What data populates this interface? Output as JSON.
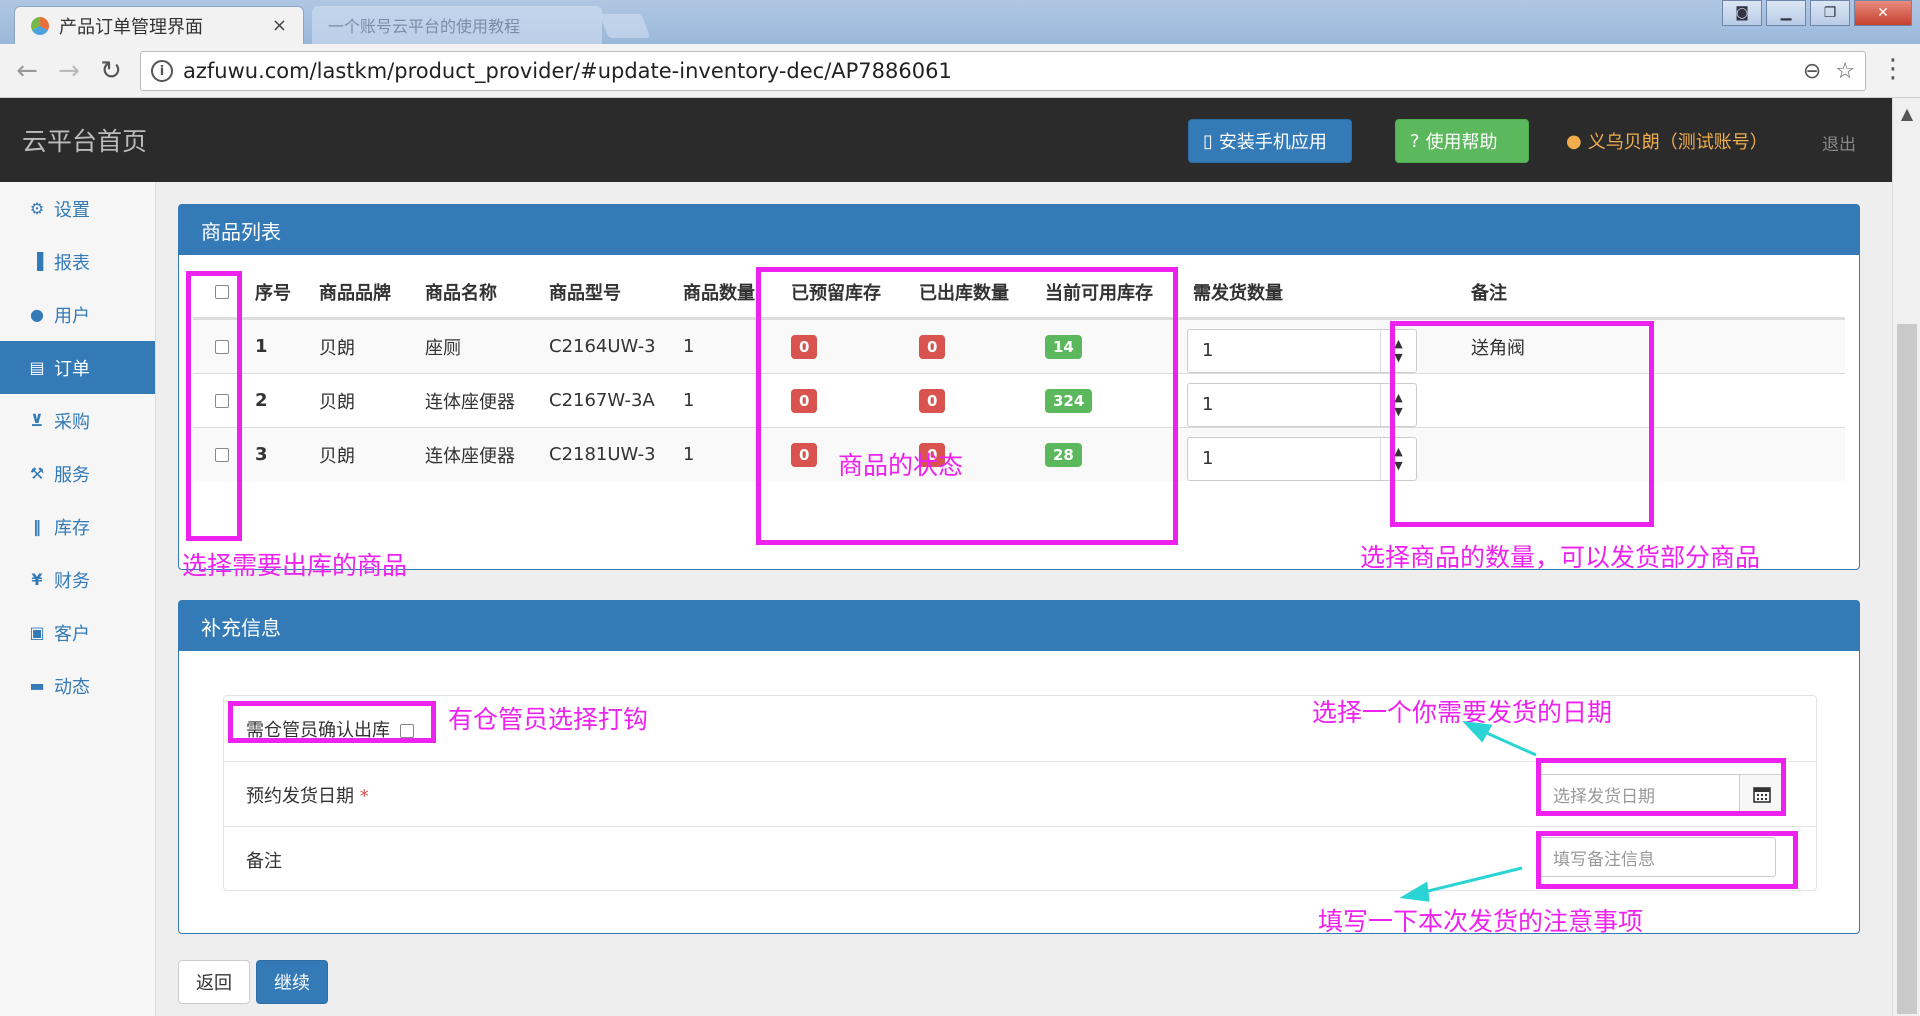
{
  "browser": {
    "tab_title": "产品订单管理界面",
    "tab_close": "×",
    "tab2_title": "一个账号云平台的使用教程",
    "url": "azfuwu.com/lastkm/product_provider/#update-inventory-dec/AP7886061",
    "back": "←",
    "forward": "→",
    "reload": "↻",
    "menu": "⋮"
  },
  "topnav": {
    "brand": "云平台首页",
    "install_label": "安装手机应用",
    "help_label": "使用帮助",
    "user_label": "义乌贝朗（测试账号）",
    "logout_label": "退出"
  },
  "sidebar": {
    "items": [
      {
        "label": "设置",
        "icon": "⚙"
      },
      {
        "label": "报表",
        "icon": "▐"
      },
      {
        "label": "用户",
        "icon": "●"
      },
      {
        "label": "订单",
        "icon": "▤"
      },
      {
        "label": "采购",
        "icon": "⊻"
      },
      {
        "label": "服务",
        "icon": "⚒"
      },
      {
        "label": "库存",
        "icon": "‖"
      },
      {
        "label": "财务",
        "icon": "¥"
      },
      {
        "label": "客户",
        "icon": "▣"
      },
      {
        "label": "动态",
        "icon": "▬"
      }
    ],
    "active_index": 3
  },
  "products_panel": {
    "title": "商品列表",
    "headers": [
      "序号",
      "商品品牌",
      "商品名称",
      "商品型号",
      "商品数量",
      "已预留库存",
      "已出库数量",
      "当前可用库存",
      "需发货数量",
      "备注"
    ],
    "rows": [
      {
        "seq": "1",
        "brand": "贝朗",
        "name": "座厕",
        "model": "C2164UW-3",
        "qty": "1",
        "reserved": "0",
        "shipped": "0",
        "available": "14",
        "ship_qty": "1",
        "note": "送角阀"
      },
      {
        "seq": "2",
        "brand": "贝朗",
        "name": "连体座便器",
        "model": "C2167W-3A",
        "qty": "1",
        "reserved": "0",
        "shipped": "0",
        "available": "324",
        "ship_qty": "1",
        "note": ""
      },
      {
        "seq": "3",
        "brand": "贝朗",
        "name": "连体座便器",
        "model": "C2181UW-3",
        "qty": "1",
        "reserved": "0",
        "shipped": "0",
        "available": "28",
        "ship_qty": "1",
        "note": ""
      }
    ]
  },
  "extra_panel": {
    "title": "补充信息",
    "confirm_label": "需仓管员确认出库",
    "date_label": "预约发货日期",
    "required_mark": "*",
    "date_placeholder": "选择发货日期",
    "note_label": "备注",
    "note_placeholder": "填写备注信息"
  },
  "buttons": {
    "back": "返回",
    "next": "继续"
  },
  "annotations": {
    "select_products": "选择需要出库的商品",
    "product_status": "商品的状态",
    "select_quantity": "选择商品的数量，可以发货部分商品",
    "warehouse_check": "有仓管员选择打钩",
    "select_date": "选择一个你需要发货的日期",
    "fill_note": "填写一下本次发货的注意事项"
  }
}
